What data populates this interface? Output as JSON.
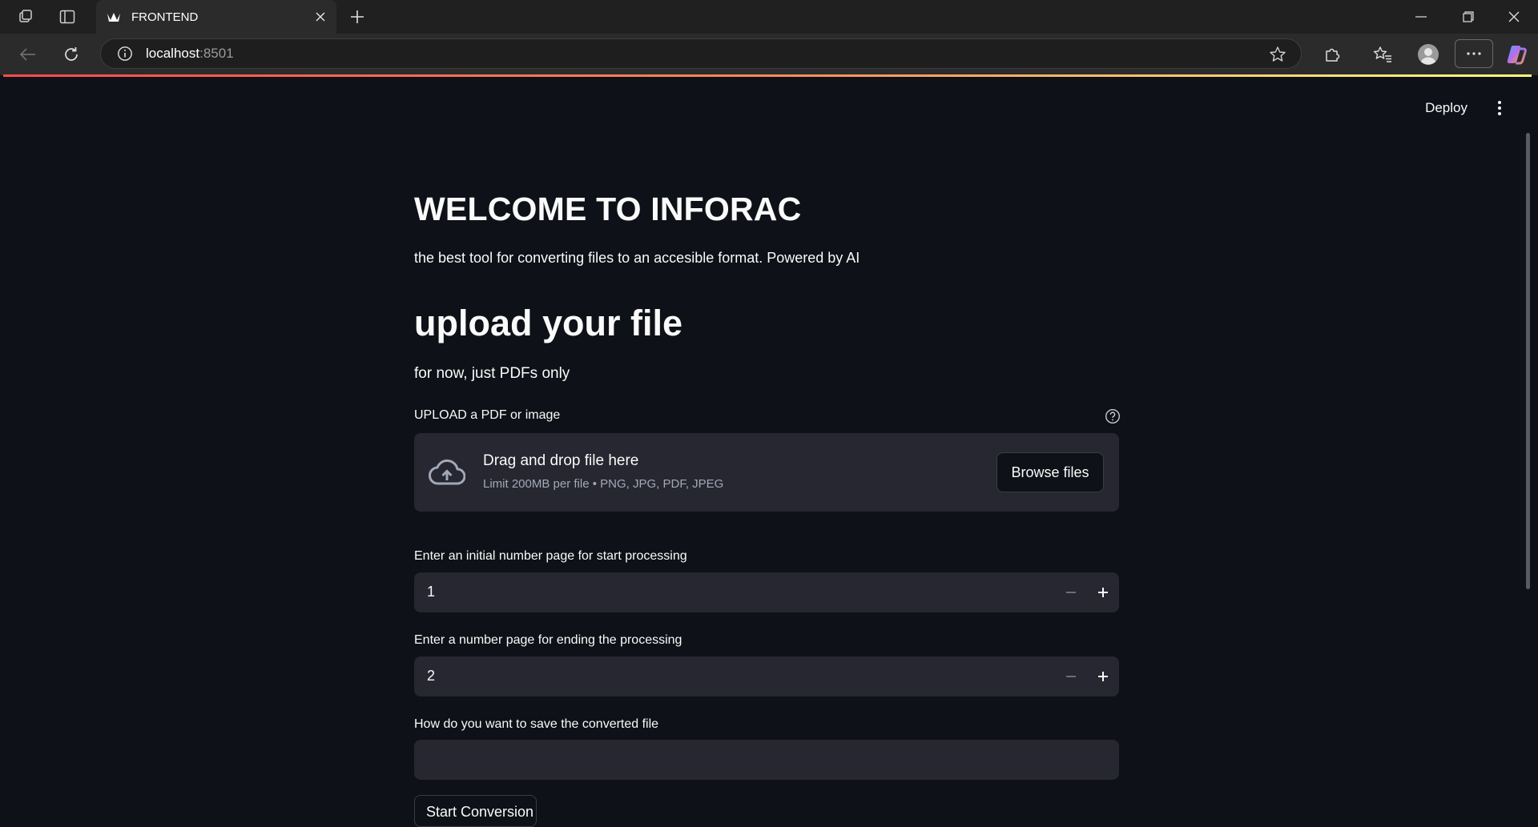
{
  "browser": {
    "tab_title": "FRONTEND",
    "url_host": "localhost",
    "url_port": ":8501"
  },
  "app_header": {
    "deploy_label": "Deploy"
  },
  "main": {
    "title": "WELCOME TO INFORAC",
    "subtitle": "the best tool for converting files to an accesible format. Powered by AI",
    "upload_heading": "upload your file",
    "upload_note": "for now, just PDFs only",
    "uploader": {
      "label": "UPLOAD a PDF or image",
      "drag_text": "Drag and drop file here",
      "limit_text": "Limit 200MB per file • PNG, JPG, PDF, JPEG",
      "browse_label": "Browse files"
    },
    "start_page": {
      "label": "Enter an initial number page for start processing",
      "value": "1"
    },
    "end_page": {
      "label": "Enter a number page for ending the processing",
      "value": "2"
    },
    "save_name": {
      "label": "How do you want to save the converted file",
      "value": ""
    },
    "start_button_label": "Start Conversion"
  },
  "colors": {
    "background": "#0e1117",
    "widget_bg": "#262730",
    "accent_gradient_start": "#ff4b4b",
    "accent_gradient_end": "#fffd80"
  }
}
